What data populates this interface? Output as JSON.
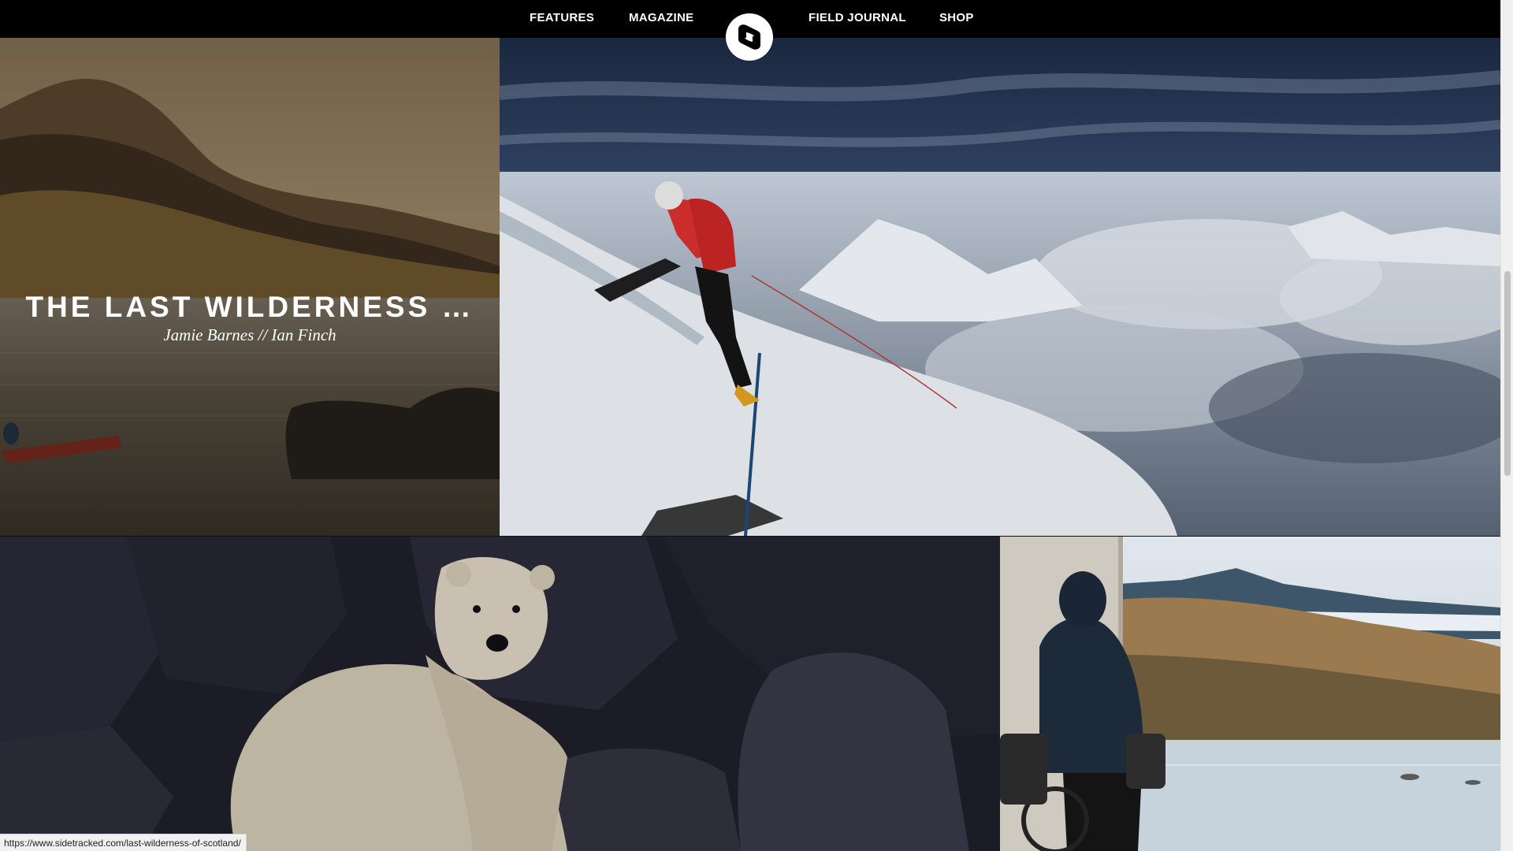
{
  "nav": {
    "links": [
      {
        "label": "FEATURES"
      },
      {
        "label": "MAGAZINE"
      },
      {
        "label": "FIELD JOURNAL"
      },
      {
        "label": "SHOP"
      }
    ],
    "logo_icon": "sidetracked-logo-icon"
  },
  "tiles": {
    "featured": {
      "title": "THE LAST WILDERNESS …",
      "byline": "Jamie Barnes // Ian Finch"
    }
  },
  "status_bar": {
    "url": "https://www.sidetracked.com/last-wilderness-of-scotland/"
  },
  "colors": {
    "nav_background": "#000000",
    "nav_text": "#ffffff"
  }
}
